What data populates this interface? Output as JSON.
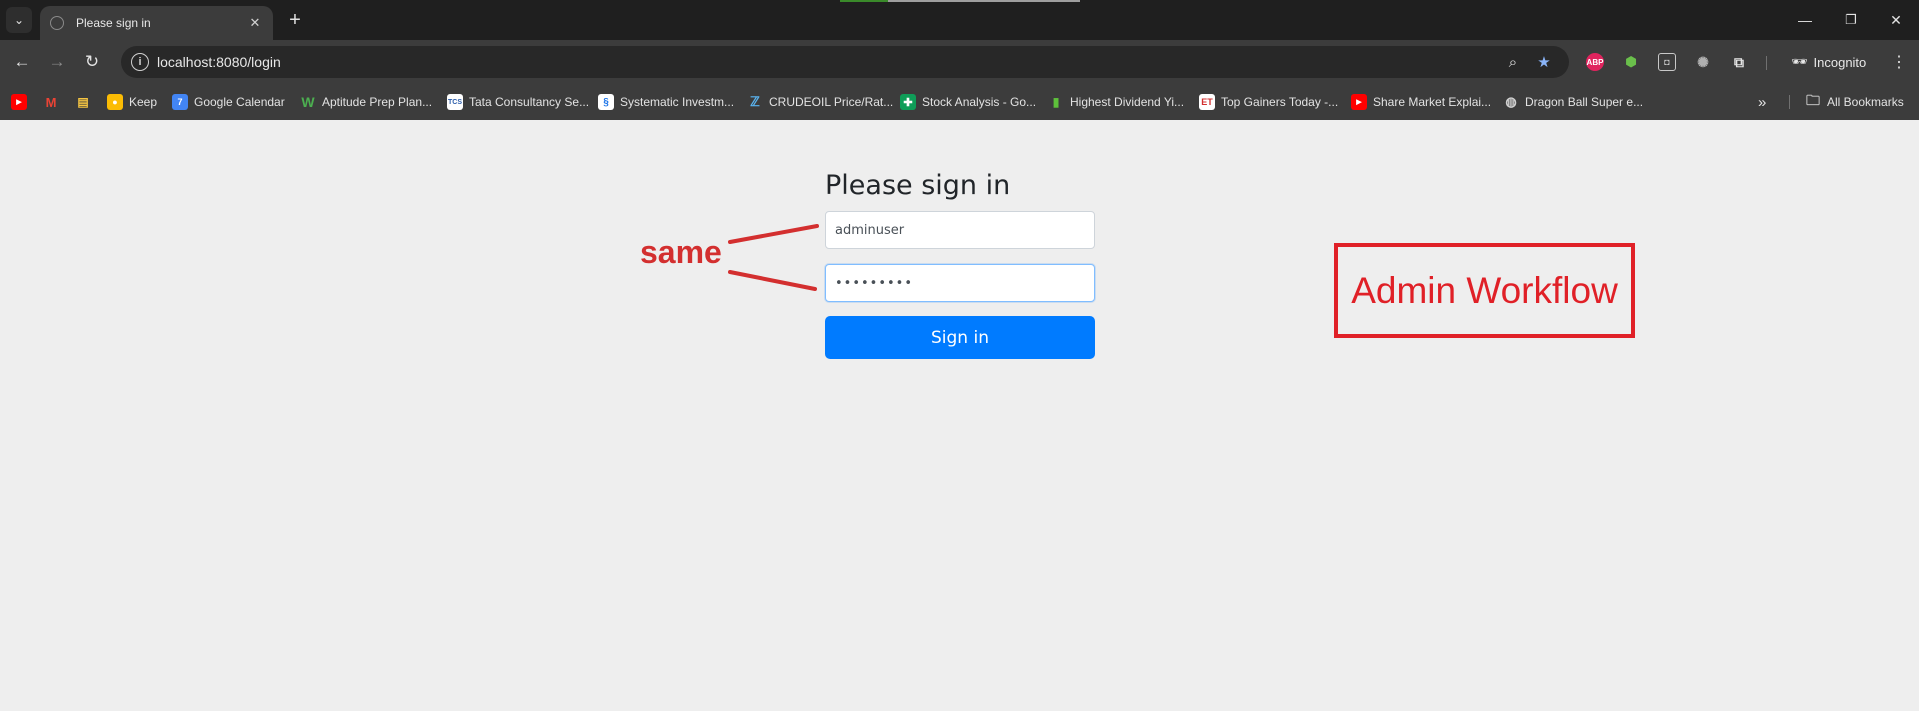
{
  "browser": {
    "tab_title": "Please sign in",
    "url": "localhost:8080/login",
    "incognito_label": "Incognito",
    "all_bookmarks_label": "All Bookmarks",
    "bookmarks": [
      {
        "label": "",
        "icon": "youtube-icon"
      },
      {
        "label": "",
        "icon": "gmail-icon"
      },
      {
        "label": "",
        "icon": "folder-app-icon"
      },
      {
        "label": "Keep",
        "icon": "keep-icon"
      },
      {
        "label": "Google Calendar",
        "icon": "calendar-icon"
      },
      {
        "label": "Aptitude Prep Plan...",
        "icon": "prep-icon"
      },
      {
        "label": "Tata Consultancy Se...",
        "icon": "tcs-icon"
      },
      {
        "label": "Systematic Investm...",
        "icon": "sip-icon"
      },
      {
        "label": "CRUDEOIL Price/Rat...",
        "icon": "crude-icon"
      },
      {
        "label": "Stock Analysis - Go...",
        "icon": "sheets-icon"
      },
      {
        "label": "Highest Dividend Yi...",
        "icon": "bar-chart-icon"
      },
      {
        "label": "Top Gainers Today -...",
        "icon": "et-icon"
      },
      {
        "label": "Share Market Explai...",
        "icon": "youtube-icon"
      },
      {
        "label": "Dragon Ball Super e...",
        "icon": "globe-icon"
      }
    ]
  },
  "login": {
    "heading": "Please sign in",
    "username_value": "adminuser",
    "password_value": "•••••••••",
    "submit_label": "Sign in"
  },
  "annotations": {
    "same_label": "same",
    "box_label": "Admin Workflow",
    "color": "#e02027"
  }
}
